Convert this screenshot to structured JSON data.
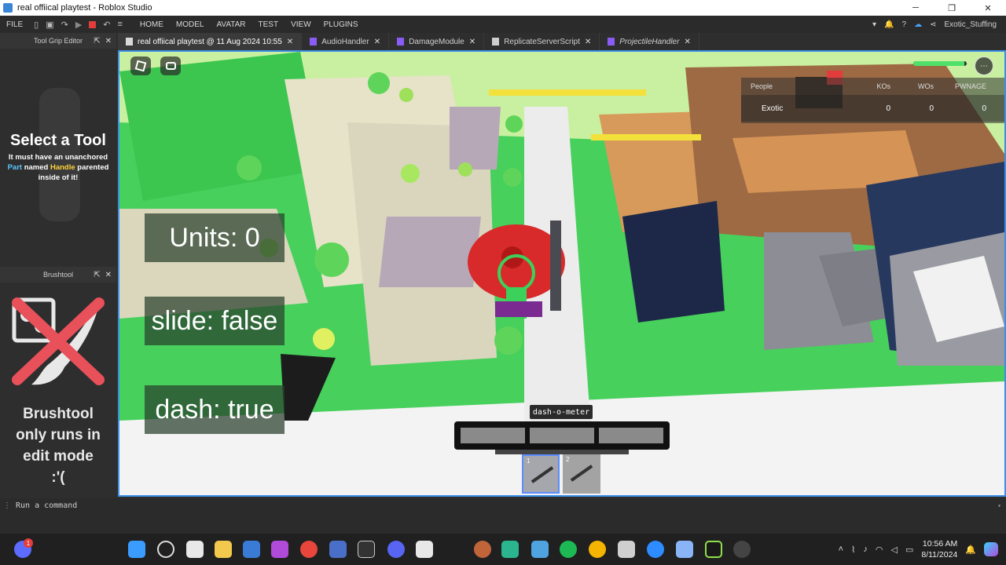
{
  "window": {
    "title": "real offiical playtest - Roblox Studio",
    "min_glyph": "─",
    "max_glyph": "❐",
    "close_glyph": "✕"
  },
  "menubar": {
    "file_label": "FILE",
    "menus": [
      "HOME",
      "MODEL",
      "AVATAR",
      "TEST",
      "VIEW",
      "PLUGINS"
    ],
    "user_name": "Exotic_Stuffing"
  },
  "tabs": [
    {
      "label": "real offiical playtest @ 11 Aug 2024 10:55",
      "active": true
    },
    {
      "label": "AudioHandler",
      "active": false
    },
    {
      "label": "DamageModule",
      "active": false
    },
    {
      "label": "ReplicateServerScript",
      "active": false
    },
    {
      "label": "ProjectileHandler",
      "active": false
    }
  ],
  "tool_grip_panel": {
    "title": "Tool Grip Editor",
    "heading": "Select a Tool",
    "desc_1": "It must have an unanchored",
    "desc_part": "Part",
    "desc_named": " named ",
    "desc_handle": "Handle",
    "desc_parented": " parented",
    "desc_2": "inside of it!"
  },
  "brush_panel": {
    "title": "Brushtool",
    "message_lines": [
      "Brushtool",
      "only runs in",
      "edit mode",
      ":'("
    ]
  },
  "hud": {
    "units_text": "Units: 0",
    "slide_text": "slide: false",
    "dash_text": "dash: true",
    "dash_tooltip": "dash-o-meter",
    "dash_segments": 3,
    "health_fraction": 0.95,
    "menu_glyph": "⋯",
    "hotbar": [
      {
        "num": "1",
        "selected": true
      },
      {
        "num": "2",
        "selected": false
      }
    ]
  },
  "leaderboard": {
    "headers": [
      "People",
      "KOs",
      "WOs",
      "PWNAGE"
    ],
    "rows": [
      {
        "name": "Exotic",
        "kos": "0",
        "wos": "0",
        "pwnage": "0"
      }
    ]
  },
  "command_bar": {
    "placeholder": "Run a command"
  },
  "taskbar": {
    "time": "10:56 AM",
    "date": "8/11/2024",
    "notification_count": "1"
  },
  "colors": {
    "accent": "#3b8fe6",
    "viewport_ground": "#3fd35a",
    "stop": "#e23c3c"
  }
}
